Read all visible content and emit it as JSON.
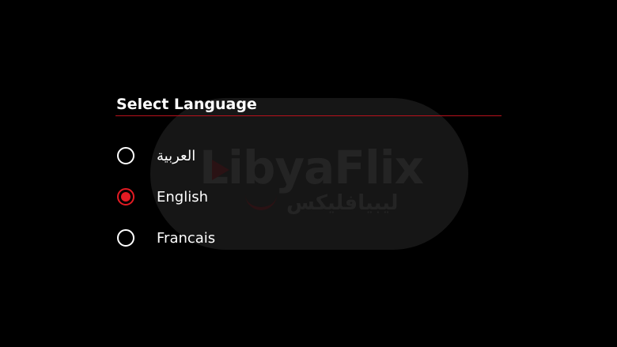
{
  "watermark": {
    "logo_text": "LibyaFlix",
    "logo_arabic": "ليبيافليكس"
  },
  "dialog": {
    "title": "Select Language",
    "options": [
      {
        "label": "العربية",
        "selected": false
      },
      {
        "label": "English",
        "selected": true
      },
      {
        "label": "Francais",
        "selected": false
      }
    ]
  },
  "colors": {
    "background": "#000000",
    "accent": "#e31b23",
    "divider": "#b8111c",
    "text": "#ffffff"
  }
}
